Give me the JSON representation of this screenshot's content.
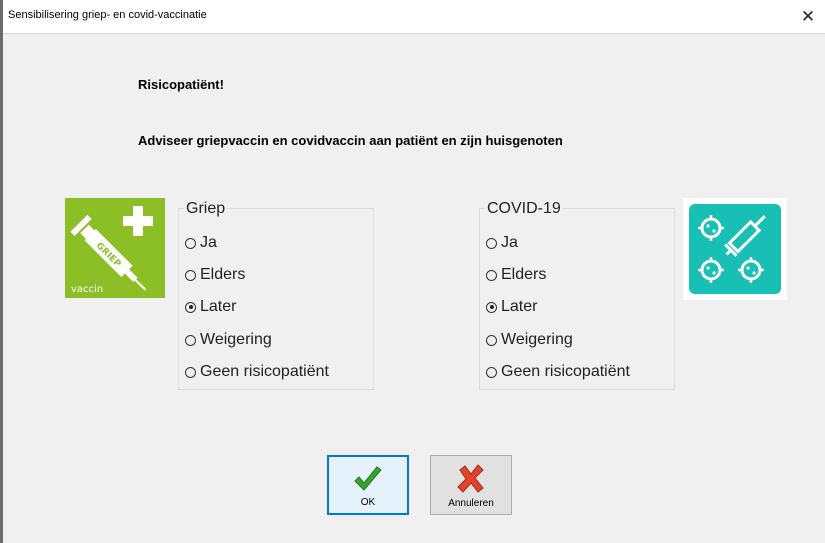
{
  "window": {
    "title": "Sensibilisering griep- en covid-vaccinatie",
    "close_glyph": "✕"
  },
  "messages": {
    "heading": "Risicopatiënt!",
    "advice": "Adviseer griepvaccin en covidvaccin aan patiënt en zijn huisgenoten"
  },
  "icons": {
    "griep": {
      "name": "syringe-plus-icon",
      "caption": "vaccin",
      "label": "GRIEP",
      "color": "#8cbf26"
    },
    "covid": {
      "name": "virus-syringe-icon",
      "color": "#17bfb4"
    }
  },
  "groups": [
    {
      "title": "Griep",
      "options": [
        {
          "label": "Ja",
          "checked": false
        },
        {
          "label": "Elders",
          "checked": false
        },
        {
          "label": "Later",
          "checked": true
        },
        {
          "label": "Weigering",
          "checked": false
        },
        {
          "label": "Geen risicopatiënt",
          "checked": false
        }
      ]
    },
    {
      "title": "COVID-19",
      "options": [
        {
          "label": "Ja",
          "checked": false
        },
        {
          "label": "Elders",
          "checked": false
        },
        {
          "label": "Later",
          "checked": true
        },
        {
          "label": "Weigering",
          "checked": false
        },
        {
          "label": "Geen risicopatiënt",
          "checked": false
        }
      ]
    }
  ],
  "buttons": {
    "ok_label": "OK",
    "cancel_label": "Annuleren",
    "ok_icon": "green-checkmark-icon",
    "cancel_icon": "red-x-icon"
  }
}
